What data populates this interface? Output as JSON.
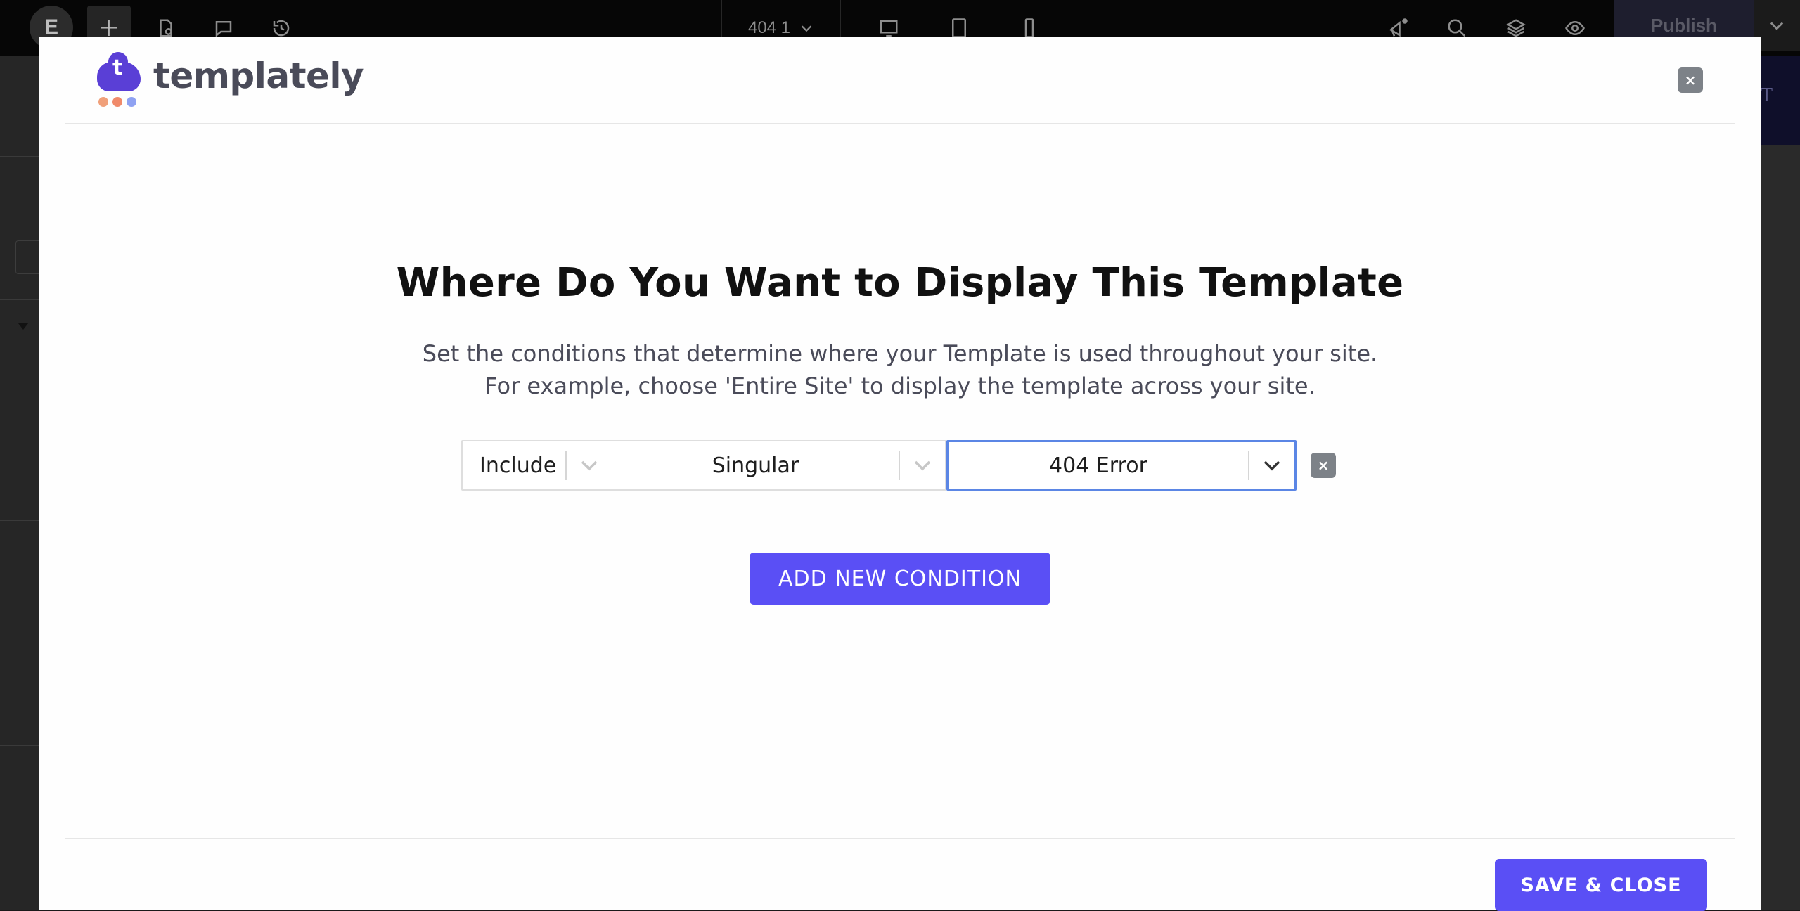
{
  "editor": {
    "topbar": {
      "logo_glyph": "E",
      "add_glyph": "+",
      "page_name": "404 1",
      "publish_label": "Publish",
      "icons": [
        "elementor-logo-icon",
        "add-element-icon",
        "page-settings-icon",
        "comments-icon",
        "history-icon",
        "desktop-icon",
        "tablet-icon",
        "mobile-icon",
        "notifications-icon",
        "search-icon",
        "structure-icon",
        "preview-icon",
        "chevron-down-icon"
      ]
    },
    "right_strip_text": "T"
  },
  "modal": {
    "brand": {
      "name": "templately",
      "logo_letter": "t",
      "dot_colors": [
        "#f0a07a",
        "#f08a6a",
        "#8fa2f2"
      ],
      "accent_color": "#5a3fd6"
    },
    "close_glyph": "×",
    "heading": "Where Do You Want to Display This Template",
    "description_line1": "Set the conditions that determine where your Template is used throughout your site.",
    "description_line2": "For example, choose 'Entire Site' to display the template across your site.",
    "condition": {
      "type": "Include",
      "scope": "Singular",
      "target": "404 Error",
      "remove_glyph": "×"
    },
    "add_button_label": "ADD NEW CONDITION",
    "save_button_label": "SAVE & CLOSE",
    "button_color": "#5a4ff5",
    "focus_color": "#5b86e5"
  }
}
